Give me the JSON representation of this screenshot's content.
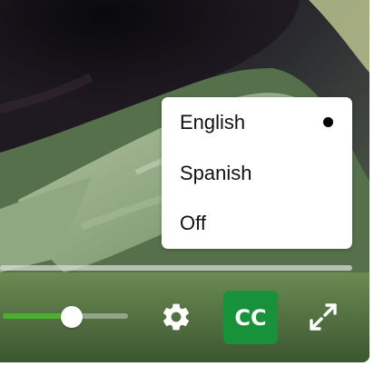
{
  "player": {
    "volume_level": 0.55,
    "volume_color": "#4caf2f",
    "settings_icon": "gear-icon",
    "fullscreen_icon": "expand-icon",
    "cc": {
      "label": "CC",
      "active": true,
      "color": "#17913a"
    }
  },
  "caption_menu": {
    "items": [
      {
        "label": "English",
        "selected": true
      },
      {
        "label": "Spanish",
        "selected": false
      },
      {
        "label": "Off",
        "selected": false
      }
    ]
  }
}
